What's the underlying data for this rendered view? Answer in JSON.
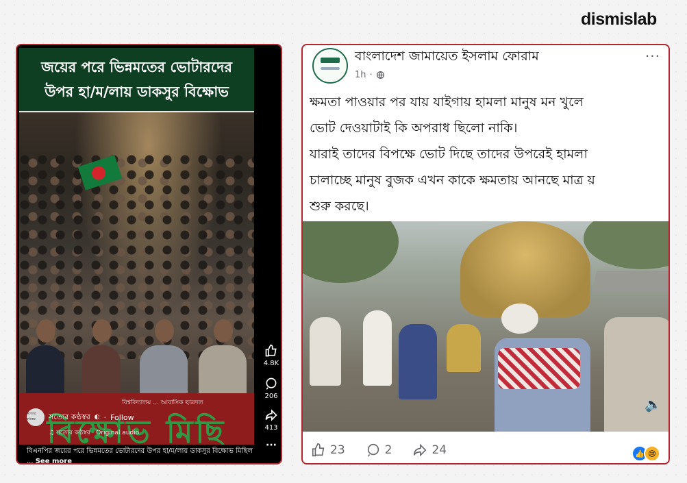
{
  "brand": "dismislab",
  "reel": {
    "headline_line1": "জয়ের পরে ভিন্নমতের ভোটারদের",
    "headline_line2": "উপর হা/ম/লায় ডাকসুর বিক্ষোভ",
    "banner_small": "বিশ্ববিদ্যালয় ... আবাসিক ছাত্রদল",
    "banner_big": "বিক্ষোভ মিছি",
    "like_count": "4.8K",
    "comment_count": "206",
    "share_count": "413",
    "more_label": "···",
    "avatar_text": "সত্যের কণ্ঠস্বর",
    "author": "সত্যের কণ্ঠস্বর",
    "follow_label": "Follow",
    "audio": "সত্যের কণ্ঠস্বর · Original audio",
    "caption": "বিএনপির জয়ের পরে ভিন্নমতের ভোটারদের উপর হা/ম/লায় ডাকসুর বিক্ষোভ মিছিল ...",
    "see_more": "See more"
  },
  "post": {
    "page_name": "বাংলাদেশ জামায়েত ইসলাম ফোরাম",
    "time": "1h",
    "more_label": "···",
    "text_lines": [
      "ক্ষমতা পাওয়ার পর যায় যাইগায় হামলা মানুষ মন খুলে",
      "ভোট দেওয়াটাই কি অপরাধ ছিলো নাকি।",
      "যারাই তাদের বিপক্ষে ভোট দিছে তাদের উপরেই হামলা",
      "চালাচ্ছে মানুষ বুজক এখন কাকে ক্ষমতায় আনছে মাত্র য়",
      "শুরু করছে।"
    ],
    "like_count": "23",
    "comment_count": "2",
    "share_count": "24"
  },
  "colors": {
    "frame": "#b3262d",
    "reel_header": "#0f3f22",
    "banner": "#8f1c1c"
  }
}
